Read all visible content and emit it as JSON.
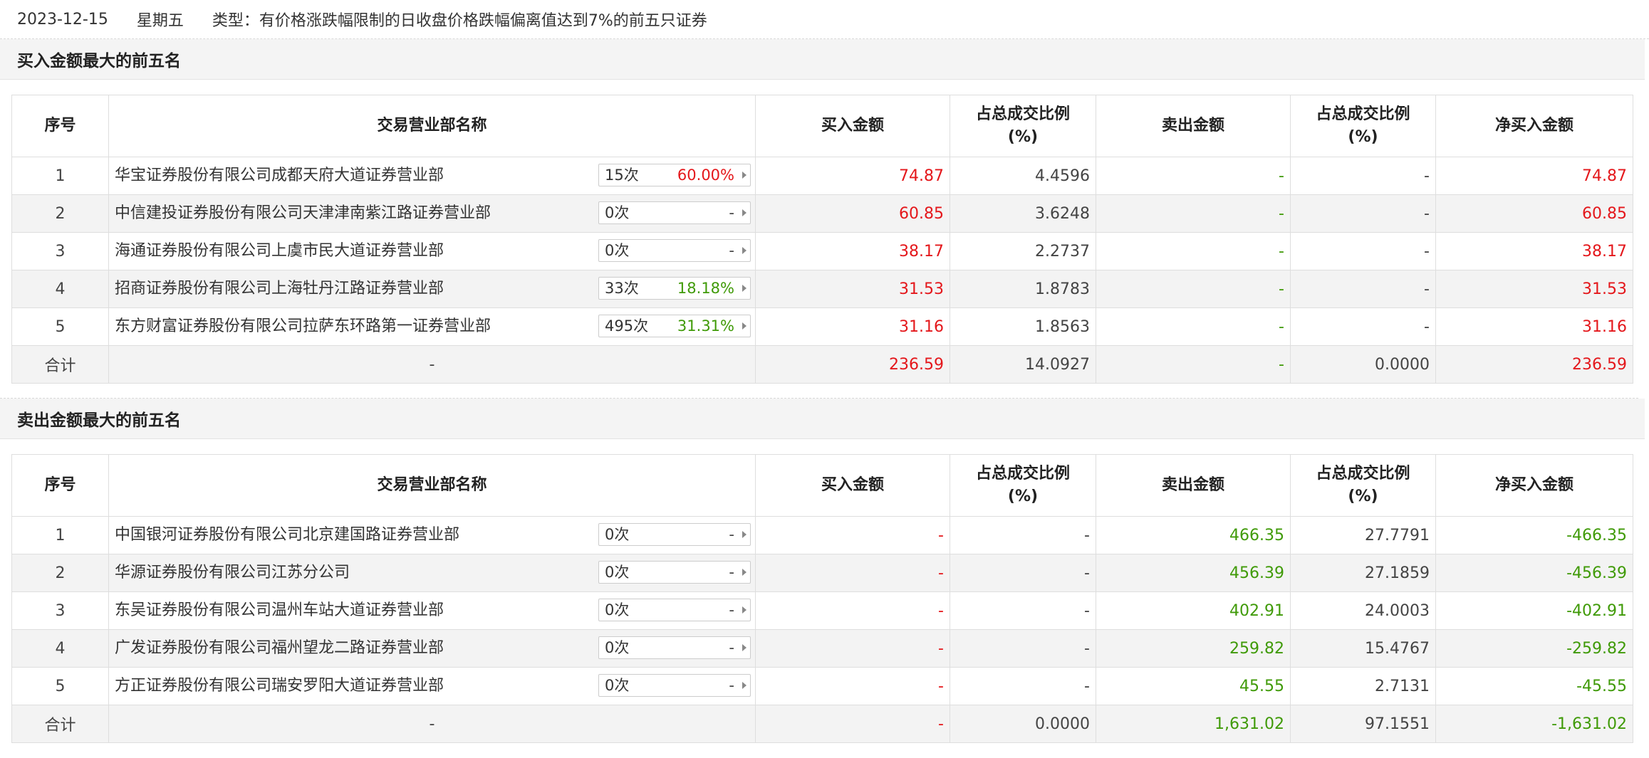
{
  "header": {
    "date": "2023-12-15",
    "weekday": "星期五",
    "type_text": "类型：有价格涨跌幅限制的日收盘价格跌幅偏离值达到7%的前五只证券"
  },
  "colors": {
    "red": "#e4171b",
    "green": "#3f9a07"
  },
  "buy_section": {
    "title": "买入金额最大的前五名",
    "columns": [
      "序号",
      "交易营业部名称",
      "买入金额",
      "占总成交比例\n(%)",
      "卖出金额",
      "占总成交比例\n(%)",
      "净买入金额"
    ],
    "rows": [
      {
        "rank": "1",
        "name": "华宝证券股份有限公司成都天府大道证券营业部",
        "count": "15次",
        "rate": "60.00%",
        "buy": "74.87",
        "buy_pct": "4.4596",
        "sell": "-",
        "sell_pct": "-",
        "net": "74.87"
      },
      {
        "rank": "2",
        "name": "中信建投证券股份有限公司天津津南紫江路证券营业部",
        "count": "0次",
        "rate": "-",
        "buy": "60.85",
        "buy_pct": "3.6248",
        "sell": "-",
        "sell_pct": "-",
        "net": "60.85"
      },
      {
        "rank": "3",
        "name": "海通证券股份有限公司上虞市民大道证券营业部",
        "count": "0次",
        "rate": "-",
        "buy": "38.17",
        "buy_pct": "2.2737",
        "sell": "-",
        "sell_pct": "-",
        "net": "38.17"
      },
      {
        "rank": "4",
        "name": "招商证券股份有限公司上海牡丹江路证券营业部",
        "count": "33次",
        "rate": "18.18%",
        "buy": "31.53",
        "buy_pct": "1.8783",
        "sell": "-",
        "sell_pct": "-",
        "net": "31.53"
      },
      {
        "rank": "5",
        "name": "东方财富证券股份有限公司拉萨东环路第一证券营业部",
        "count": "495次",
        "rate": "31.31%",
        "buy": "31.16",
        "buy_pct": "1.8563",
        "sell": "-",
        "sell_pct": "-",
        "net": "31.16"
      }
    ],
    "total": {
      "label": "合计",
      "name": "-",
      "buy": "236.59",
      "buy_pct": "14.0927",
      "sell": "-",
      "sell_pct": "0.0000",
      "net": "236.59"
    }
  },
  "sell_section": {
    "title": "卖出金额最大的前五名",
    "columns": [
      "序号",
      "交易营业部名称",
      "买入金额",
      "占总成交比例\n(%)",
      "卖出金额",
      "占总成交比例\n(%)",
      "净买入金额"
    ],
    "rows": [
      {
        "rank": "1",
        "name": "中国银河证券股份有限公司北京建国路证券营业部",
        "count": "0次",
        "rate": "-",
        "buy": "-",
        "buy_pct": "-",
        "sell": "466.35",
        "sell_pct": "27.7791",
        "net": "-466.35"
      },
      {
        "rank": "2",
        "name": "华源证券股份有限公司江苏分公司",
        "count": "0次",
        "rate": "-",
        "buy": "-",
        "buy_pct": "-",
        "sell": "456.39",
        "sell_pct": "27.1859",
        "net": "-456.39"
      },
      {
        "rank": "3",
        "name": "东吴证券股份有限公司温州车站大道证券营业部",
        "count": "0次",
        "rate": "-",
        "buy": "-",
        "buy_pct": "-",
        "sell": "402.91",
        "sell_pct": "24.0003",
        "net": "-402.91"
      },
      {
        "rank": "4",
        "name": "广发证券股份有限公司福州望龙二路证券营业部",
        "count": "0次",
        "rate": "-",
        "buy": "-",
        "buy_pct": "-",
        "sell": "259.82",
        "sell_pct": "15.4767",
        "net": "-259.82"
      },
      {
        "rank": "5",
        "name": "方正证券股份有限公司瑞安罗阳大道证券营业部",
        "count": "0次",
        "rate": "-",
        "buy": "-",
        "buy_pct": "-",
        "sell": "45.55",
        "sell_pct": "2.7131",
        "net": "-45.55"
      }
    ],
    "total": {
      "label": "合计",
      "name": "-",
      "buy": "-",
      "buy_pct": "0.0000",
      "sell": "1,631.02",
      "sell_pct": "97.1551",
      "net": "-1,631.02"
    }
  }
}
